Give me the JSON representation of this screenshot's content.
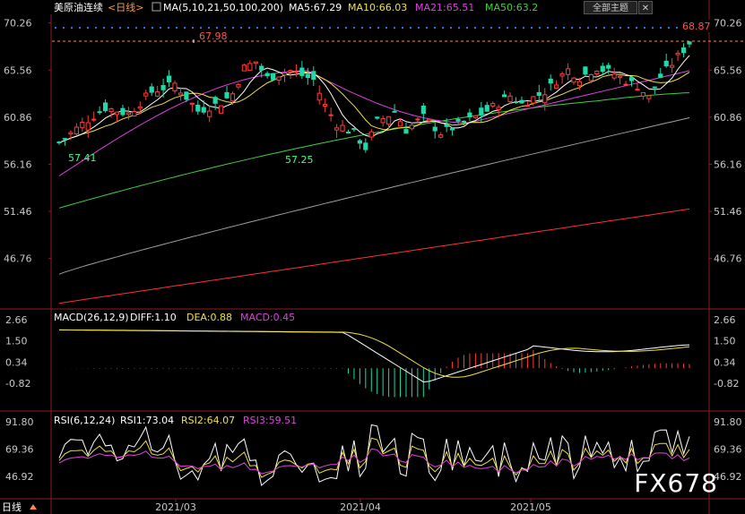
{
  "header": {
    "instrument": "美原油连续",
    "period_link": "<日线>",
    "ma_label": "MA(5,10,21,50,100,200)",
    "ma5": "MA5:67.29",
    "ma10": "MA10:66.03",
    "ma21": "MA21:65.51",
    "ma50": "MA50:63.2",
    "theme_button": "全部主题",
    "close_button": "✕"
  },
  "colors": {
    "up": "#ff3b3b",
    "down": "#20d8a8",
    "ma5": "#ffffff",
    "ma10": "#f0e040",
    "ma21": "#e040e0",
    "ma50": "#40d040",
    "ma100": "#a0a0a0",
    "ma200": "#ff3030",
    "axis": "#8a1e1e",
    "label_red": "#ff5050",
    "label_green": "#40ff80"
  },
  "price_axis": {
    "ticks": [
      "70.26",
      "65.56",
      "60.86",
      "56.16",
      "51.46",
      "46.76"
    ],
    "min": 42.0,
    "max": 71.3
  },
  "price_annotations": {
    "high_label": "67.98",
    "low1_label": "57.41",
    "low2_label": "57.25",
    "last_label": "68.87"
  },
  "macd": {
    "title": "MACD(26,12,9)",
    "diff": "DIFF:1.10",
    "dea": "DEA:0.88",
    "macd": "MACD:0.45",
    "ticks": [
      "2.66",
      "1.50",
      "0.34",
      "-0.82"
    ]
  },
  "rsi": {
    "title": "RSI(6,12,24)",
    "rsi1": "RSI1:73.04",
    "rsi2": "RSI2:64.07",
    "rsi3": "RSI3:59.51",
    "ticks": [
      "91.80",
      "69.36",
      "46.92"
    ]
  },
  "x_axis": {
    "period": "日线",
    "dates": [
      "2021/03",
      "2021/04",
      "2021/05"
    ]
  },
  "watermark": "FX678",
  "chart_data": {
    "type": "candlestick",
    "series": [
      {
        "name": "MA5",
        "values_note": "overlay"
      }
    ],
    "ylim": [
      42.0,
      71.3
    ]
  }
}
